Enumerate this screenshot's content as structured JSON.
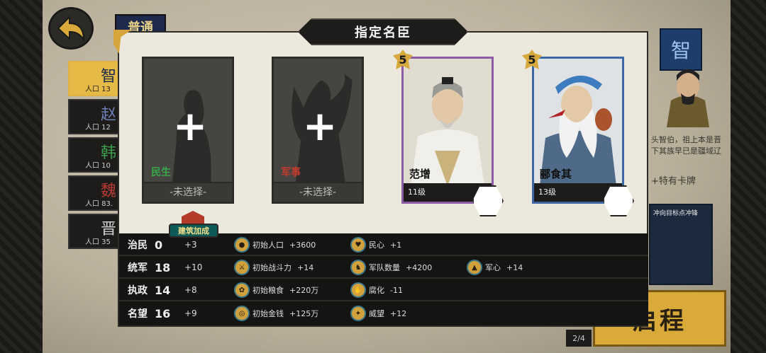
{
  "mode_tag": "普通",
  "dialog_title": "指定名臣",
  "countries": [
    {
      "name": "智",
      "pop": "人口 13",
      "active": true
    },
    {
      "name": "赵",
      "pop": "人口 12",
      "active": false
    },
    {
      "name": "韩",
      "pop": "人口 10",
      "active": false
    },
    {
      "name": "魏",
      "pop": "人口 83.",
      "active": false
    },
    {
      "name": "晋",
      "pop": "人口 35",
      "active": false
    }
  ],
  "country_colors": [
    "#9bb6e8",
    "#6d7fb4",
    "#3a9b4c",
    "#b73b34",
    "#cfcfcf"
  ],
  "right_panel": {
    "flag": "智",
    "desc": "头智伯，祖上本是晋\n下其族早已是疆域辽",
    "special": "+特有卡牌",
    "card_caption": "冲向目标点冲锋"
  },
  "slots": [
    {
      "type": "empty",
      "role": "民生",
      "role_color": "#39a848",
      "unselected": "-未选择-"
    },
    {
      "type": "empty",
      "role": "军事",
      "role_color": "#c23b2f",
      "unselected": "-未选择-"
    },
    {
      "type": "filled",
      "name": "范增",
      "level": "11级",
      "badge": "5",
      "color": "purple"
    },
    {
      "type": "filled",
      "name": "郦食其",
      "level": "13级",
      "badge": "5",
      "color": "blue"
    }
  ],
  "bonus_tag": "建筑加成",
  "stats": [
    {
      "label": "治民",
      "value": "0",
      "bonus": "+3",
      "effects": [
        {
          "name": "初始人口",
          "val": "+3600",
          "icon": "person-icon"
        },
        {
          "name": "民心",
          "val": "+1",
          "icon": "heart-icon"
        }
      ]
    },
    {
      "label": "统军",
      "value": "18",
      "bonus": "+10",
      "effects": [
        {
          "name": "初始战斗力",
          "val": "+14",
          "icon": "sword-icon"
        },
        {
          "name": "军队数量",
          "val": "+4200",
          "icon": "army-icon"
        },
        {
          "name": "军心",
          "val": "+14",
          "icon": "helmet-icon"
        }
      ]
    },
    {
      "label": "执政",
      "value": "14",
      "bonus": "+8",
      "effects": [
        {
          "name": "初始粮食",
          "val": "+220万",
          "icon": "grain-icon"
        },
        {
          "name": "腐化",
          "val": "-11",
          "icon": "corruption-icon"
        }
      ]
    },
    {
      "label": "名望",
      "value": "16",
      "bonus": "+9",
      "effects": [
        {
          "name": "初始金钱",
          "val": "+125万",
          "icon": "coin-icon"
        },
        {
          "name": "威望",
          "val": "+12",
          "icon": "prestige-icon"
        }
      ]
    }
  ],
  "start_button": "启程",
  "page_indicator": "2/4"
}
